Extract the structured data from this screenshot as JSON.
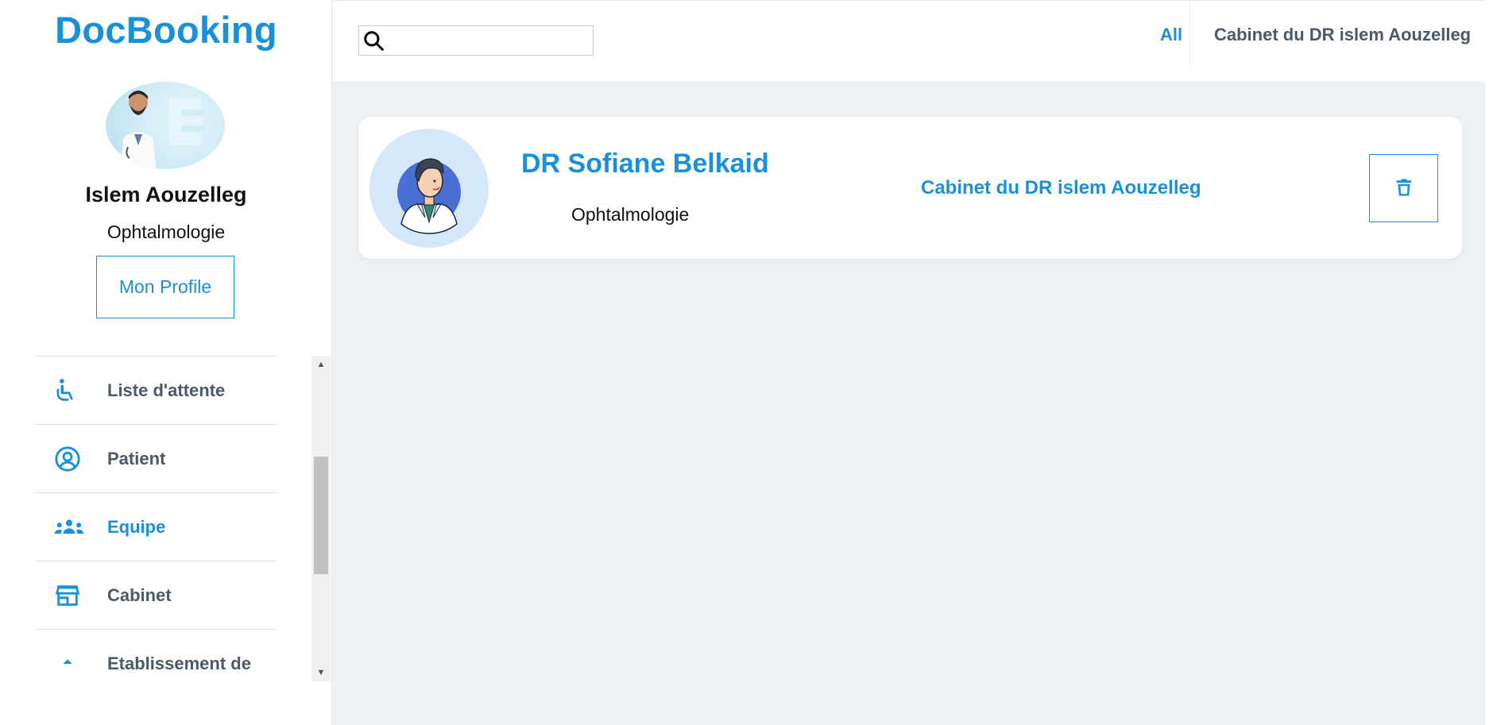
{
  "brand": {
    "name": "DocBooking"
  },
  "user": {
    "name": "Islem Aouzelleg",
    "specialty": "Ophtalmologie",
    "profile_button": "Mon Profile"
  },
  "menu": {
    "items": [
      {
        "label": "Liste d'attente",
        "icon": "wheelchair-icon",
        "active": false
      },
      {
        "label": "Patient",
        "icon": "user-circle-icon",
        "active": false
      },
      {
        "label": "Equipe",
        "icon": "group-icon",
        "active": true
      },
      {
        "label": "Cabinet",
        "icon": "store-icon",
        "active": false
      },
      {
        "label": "Etablissement de",
        "icon": "chevron-up-icon",
        "active": false
      }
    ]
  },
  "search": {
    "placeholder": "",
    "value": ""
  },
  "tabs": {
    "all": "All",
    "cabinet": "Cabinet du DR islem Aouzelleg"
  },
  "card": {
    "doctor_name": "DR Sofiane Belkaid",
    "specialty": "Ophtalmologie",
    "cabinet": "Cabinet du DR islem Aouzelleg"
  },
  "colors": {
    "accent": "#1a90d8",
    "menu_text": "#4c5a67",
    "background": "#edf0f4"
  }
}
